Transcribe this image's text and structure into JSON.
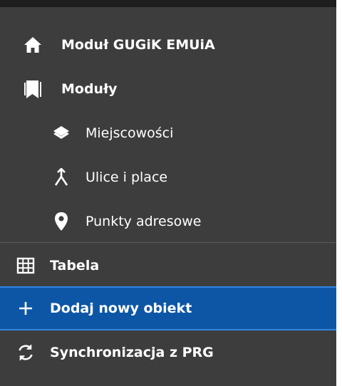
{
  "menu": {
    "items": [
      {
        "label": "Moduł GUGiK EMUiA",
        "icon": "home-icon"
      },
      {
        "label": "Moduły",
        "icon": "bookmark-icon"
      },
      {
        "label": "Miejscowości",
        "icon": "layers-icon"
      },
      {
        "label": "Ulice i place",
        "icon": "merge-icon"
      },
      {
        "label": "Punkty adresowe",
        "icon": "map-pin-icon"
      },
      {
        "label": "Tabela",
        "icon": "table-icon"
      },
      {
        "label": "Dodaj nowy obiekt",
        "icon": "plus-icon"
      },
      {
        "label": "Synchronizacja z PRG",
        "icon": "sync-icon"
      }
    ],
    "active_item": "Dodaj nowy obiekt"
  },
  "colors": {
    "menu_bg": "#3d3d3d",
    "active_bg": "#0d56a6",
    "text": "#ffffff"
  }
}
